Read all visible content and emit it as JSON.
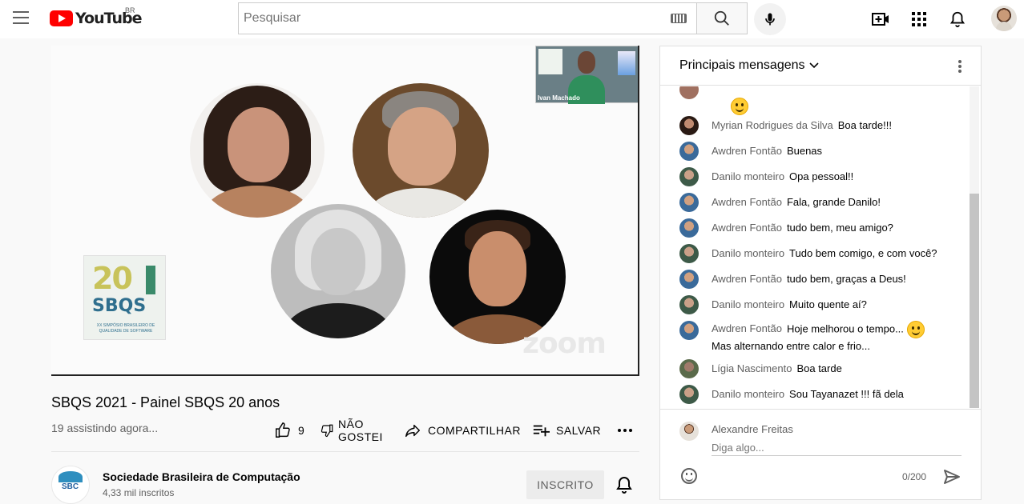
{
  "header": {
    "logo_text": "YouTube",
    "country": "BR",
    "search_placeholder": "Pesquisar"
  },
  "video": {
    "thumbnail_name": "Ivan Machado",
    "watermark": "zoom",
    "logo_number": "20",
    "logo_word": "SBQS",
    "logo_subtitle": "XX SIMPÓSIO BRASILEIRO DE QUALIDADE DE SOFTWARE"
  },
  "info": {
    "title": "SBQS 2021 - Painel SBQS 20 anos",
    "viewers": "19 assistindo agora...",
    "like_count": "9",
    "dislike_label": "NÃO GOSTEI",
    "share_label": "COMPARTILHAR",
    "save_label": "SALVAR"
  },
  "channel": {
    "name": "Sociedade Brasileira de Computação",
    "subscribers": "4,33 mil inscritos",
    "avatar_text": "SBC",
    "subscribed_label": "INSCRITO"
  },
  "chat": {
    "title": "Principais mensagens",
    "messages": [
      {
        "author": "Myrian Rodrigues da Silva",
        "text": "Boa tarde!!!",
        "emoji": false
      },
      {
        "author": "Awdren Fontão",
        "text": "Buenas",
        "emoji": false
      },
      {
        "author": "Danilo monteiro",
        "text": "Opa pessoal!!",
        "emoji": false
      },
      {
        "author": "Awdren Fontão",
        "text": "Fala, grande Danilo!",
        "emoji": false
      },
      {
        "author": "Awdren Fontão",
        "text": "tudo bem, meu amigo?",
        "emoji": false
      },
      {
        "author": "Danilo monteiro",
        "text": "Tudo bem comigo, e com você?",
        "emoji": false
      },
      {
        "author": "Awdren Fontão",
        "text": "tudo bem, graças a Deus!",
        "emoji": false
      },
      {
        "author": "Danilo monteiro",
        "text": "Muito quente aí?",
        "emoji": false
      },
      {
        "author": "Awdren Fontão",
        "text": "Hoje melhorou o tempo...",
        "emoji": true,
        "text2": "Mas alternando entre calor e frio..."
      },
      {
        "author": "Lígia Nascimento",
        "text": "Boa tarde",
        "emoji": false
      },
      {
        "author": "Danilo monteiro",
        "text": "Sou Tayanazet !!! fã dela",
        "emoji": false
      }
    ],
    "current_user": "Alexandre Freitas",
    "input_placeholder": "Diga algo...",
    "char_count": "0/200"
  },
  "colors": {
    "brand_red": "#ff0000",
    "text_secondary": "#606060",
    "subscribed_bg": "#ececec"
  }
}
